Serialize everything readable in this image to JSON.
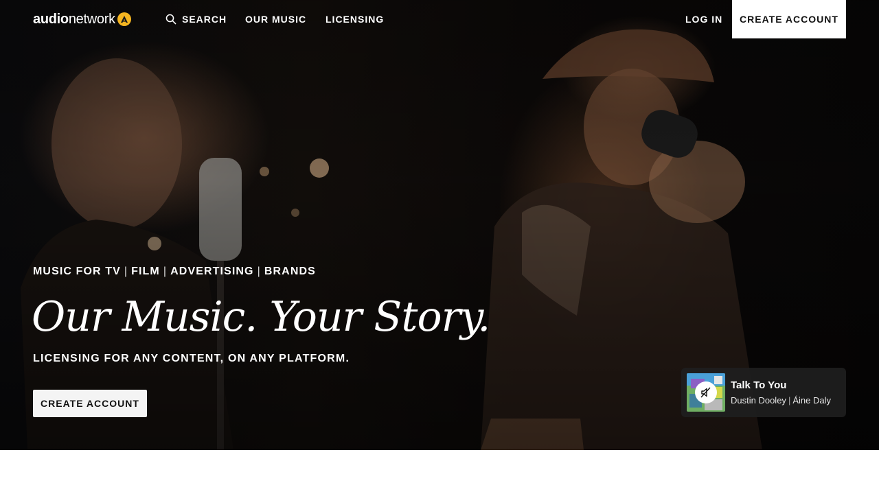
{
  "brand": {
    "logo_bold": "audio",
    "logo_light": "network",
    "logo_badge_letter": "A",
    "accent_color": "#f5b521"
  },
  "nav": {
    "search_label": "SEARCH",
    "music_label": "OUR MUSIC",
    "licensing_label": "LICENSING",
    "login_label": "LOG IN",
    "create_account_label": "CREATE ACCOUNT"
  },
  "hero": {
    "tagline_items": [
      "MUSIC FOR TV",
      "FILM",
      "ADVERTISING",
      "BRANDS"
    ],
    "headline": "Our Music. Your Story.",
    "subline": "LICENSING FOR ANY CONTENT, ON ANY PLATFORM.",
    "cta_label": "CREATE ACCOUNT"
  },
  "player": {
    "track_title": "Talk To You",
    "artist_1": "Dustin Dooley",
    "artist_2": "Áine Daly",
    "mute_icon": "speaker-muted-icon"
  }
}
